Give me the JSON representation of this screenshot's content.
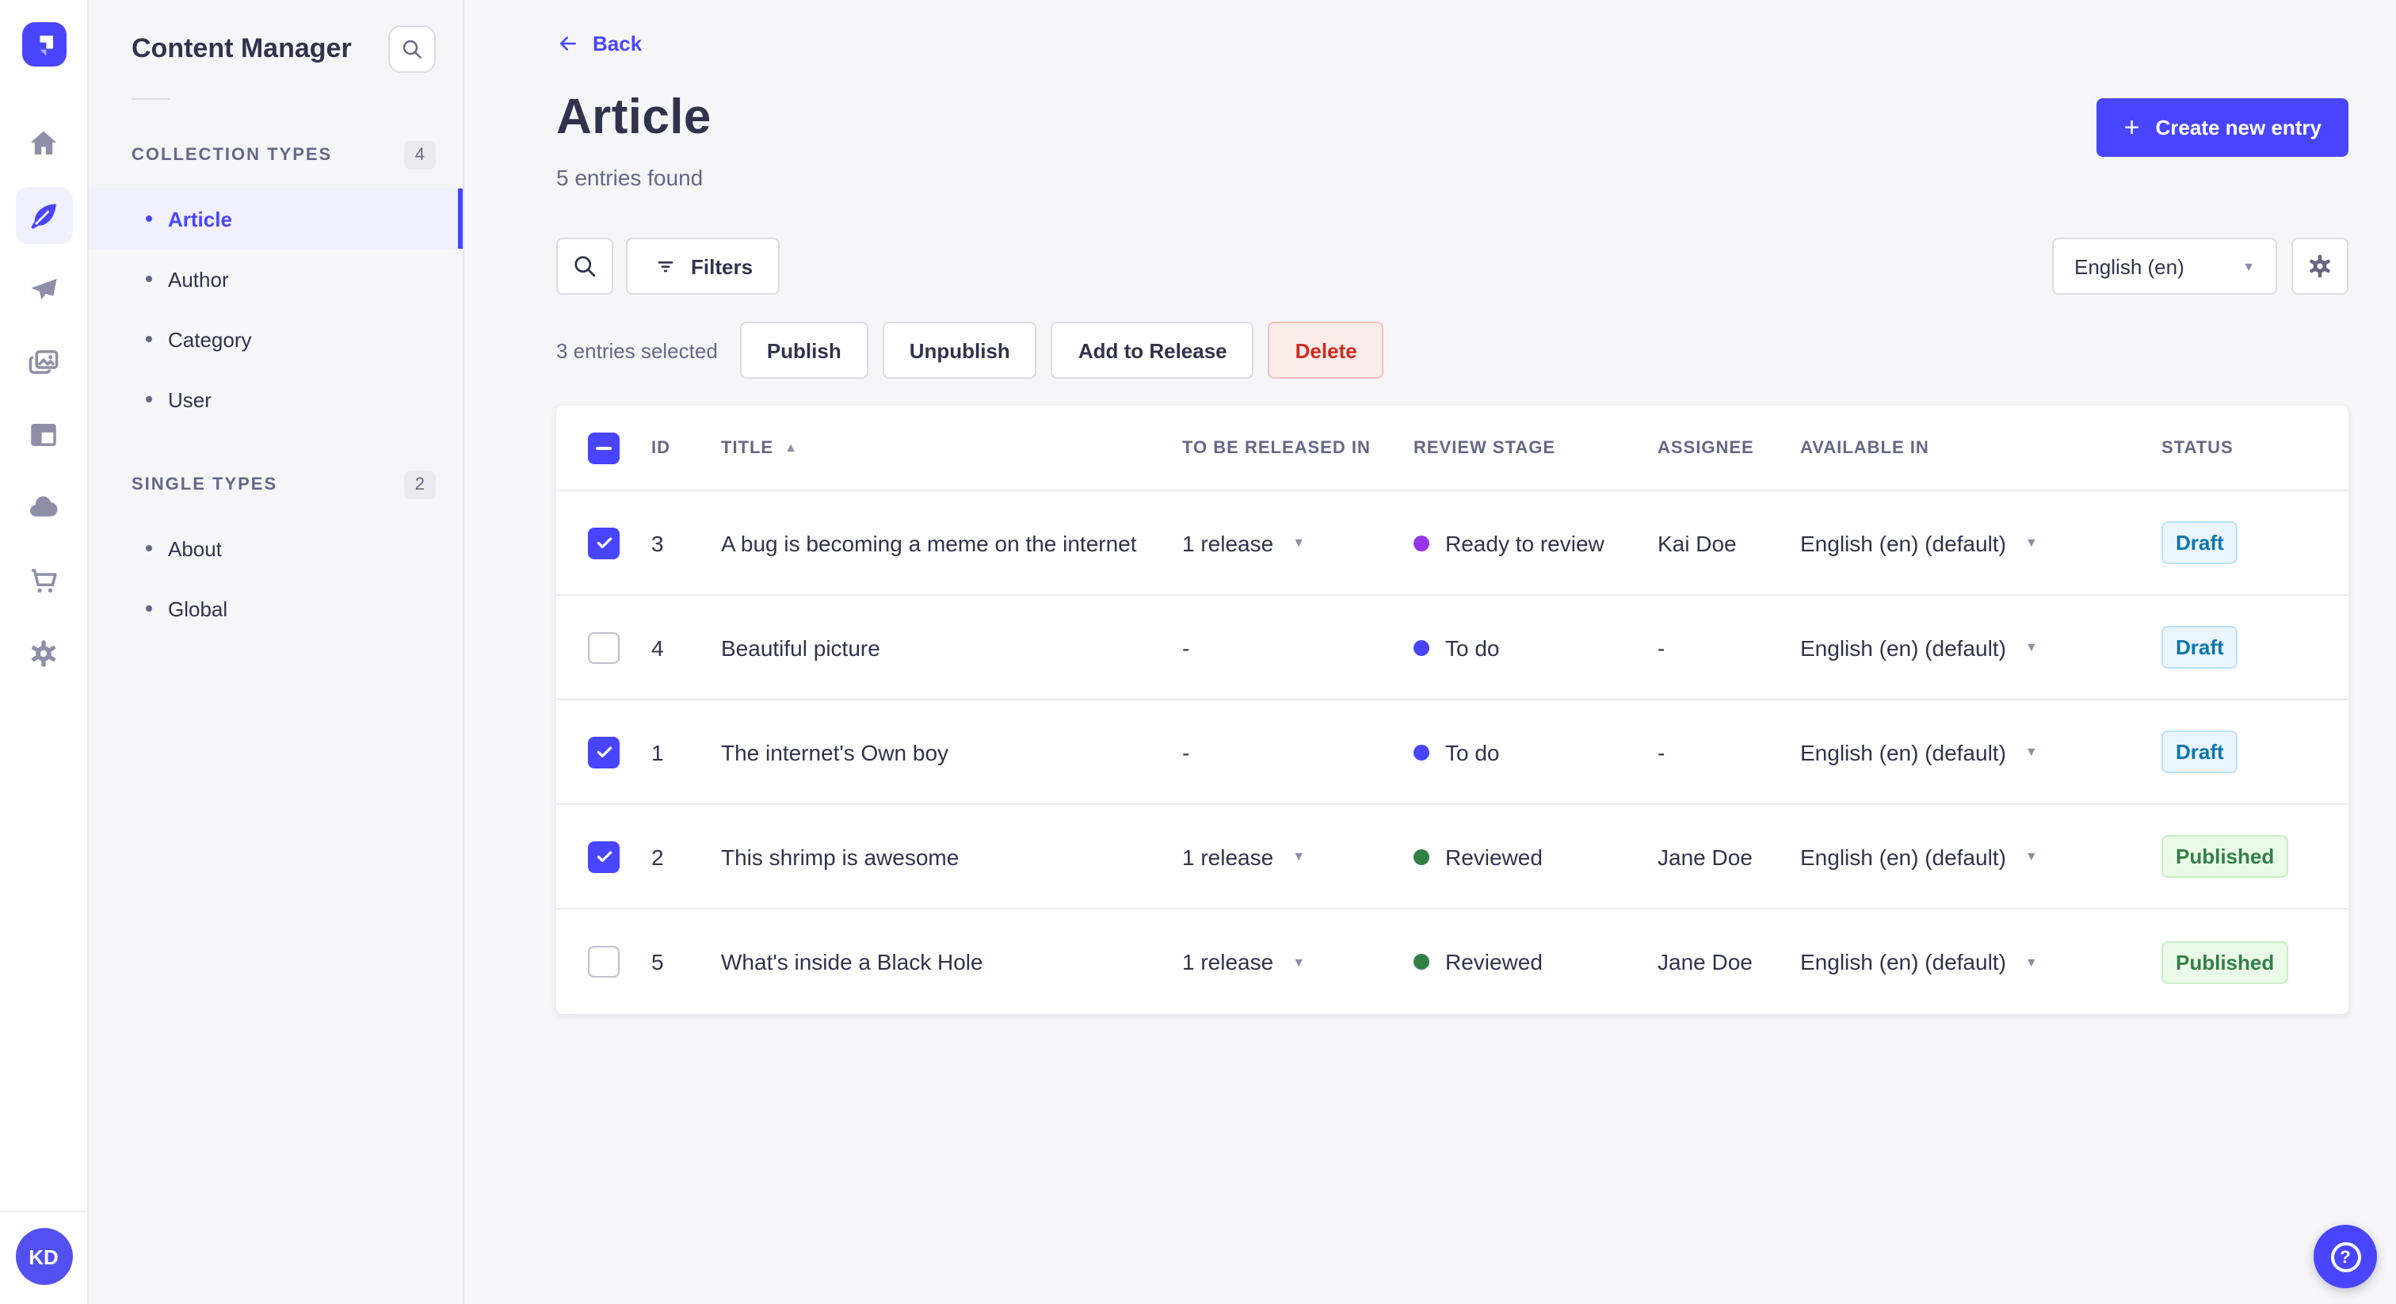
{
  "app": {
    "primary_color": "#4945ff",
    "background": "#f6f6f9"
  },
  "rail": {
    "items": [
      {
        "icon": "home-icon",
        "active": false
      },
      {
        "icon": "content-manager-icon",
        "active": true
      },
      {
        "icon": "releases-icon",
        "active": false
      },
      {
        "icon": "media-library-icon",
        "active": false
      },
      {
        "icon": "content-type-builder-icon",
        "active": false
      },
      {
        "icon": "cloud-icon",
        "active": false
      },
      {
        "icon": "marketplace-icon",
        "active": false
      },
      {
        "icon": "settings-icon",
        "active": false
      }
    ],
    "avatar_initials": "KD"
  },
  "sidebar": {
    "title": "Content Manager",
    "sections": [
      {
        "label": "COLLECTION TYPES",
        "count": "4",
        "items": [
          {
            "label": "Article",
            "active": true
          },
          {
            "label": "Author",
            "active": false
          },
          {
            "label": "Category",
            "active": false
          },
          {
            "label": "User",
            "active": false
          }
        ]
      },
      {
        "label": "SINGLE TYPES",
        "count": "2",
        "items": [
          {
            "label": "About",
            "active": false
          },
          {
            "label": "Global",
            "active": false
          }
        ]
      }
    ]
  },
  "header": {
    "back_label": "Back",
    "title": "Article",
    "subtitle": "5 entries found",
    "create_button": "Create new entry"
  },
  "toolbar": {
    "filters_label": "Filters",
    "locale_value": "English (en)"
  },
  "selection": {
    "text": "3 entries selected",
    "actions": [
      {
        "label": "Publish",
        "variant": "default"
      },
      {
        "label": "Unpublish",
        "variant": "default"
      },
      {
        "label": "Add to Release",
        "variant": "default"
      },
      {
        "label": "Delete",
        "variant": "danger"
      }
    ]
  },
  "table": {
    "columns": [
      "ID",
      "TITLE",
      "TO BE RELEASED IN",
      "REVIEW STAGE",
      "ASSIGNEE",
      "AVAILABLE IN",
      "STATUS"
    ],
    "sort_column": "TITLE",
    "sort_direction": "asc",
    "header_checkbox": "indeterminate",
    "status_colors": {
      "Draft": {
        "bg": "#eaf5ff",
        "text": "#0c75af",
        "border": "#b8e1ff"
      },
      "Published": {
        "bg": "#eafbe7",
        "text": "#328048",
        "border": "#c6f0c2"
      }
    },
    "rows": [
      {
        "checked": true,
        "id": "3",
        "title": "A bug is becoming a meme on the internet",
        "to_be_released_in": "1 release",
        "has_release_menu": true,
        "review_stage": "Ready to review",
        "stage_color": "#9736e8",
        "assignee": "Kai Doe",
        "available_in": "English (en) (default)",
        "status": "Draft"
      },
      {
        "checked": false,
        "id": "4",
        "title": "Beautiful picture",
        "to_be_released_in": "-",
        "has_release_menu": false,
        "review_stage": "To do",
        "stage_color": "#4945ff",
        "assignee": "-",
        "available_in": "English (en) (default)",
        "status": "Draft"
      },
      {
        "checked": true,
        "id": "1",
        "title": "The internet's Own boy",
        "to_be_released_in": "-",
        "has_release_menu": false,
        "review_stage": "To do",
        "stage_color": "#4945ff",
        "assignee": "-",
        "available_in": "English (en) (default)",
        "status": "Draft"
      },
      {
        "checked": true,
        "id": "2",
        "title": "This shrimp is awesome",
        "to_be_released_in": "1 release",
        "has_release_menu": true,
        "review_stage": "Reviewed",
        "stage_color": "#328048",
        "assignee": "Jane Doe",
        "available_in": "English (en) (default)",
        "status": "Published"
      },
      {
        "checked": false,
        "id": "5",
        "title": "What's inside a Black Hole",
        "to_be_released_in": "1 release",
        "has_release_menu": true,
        "review_stage": "Reviewed",
        "stage_color": "#328048",
        "assignee": "Jane Doe",
        "available_in": "English (en) (default)",
        "status": "Published"
      }
    ]
  }
}
